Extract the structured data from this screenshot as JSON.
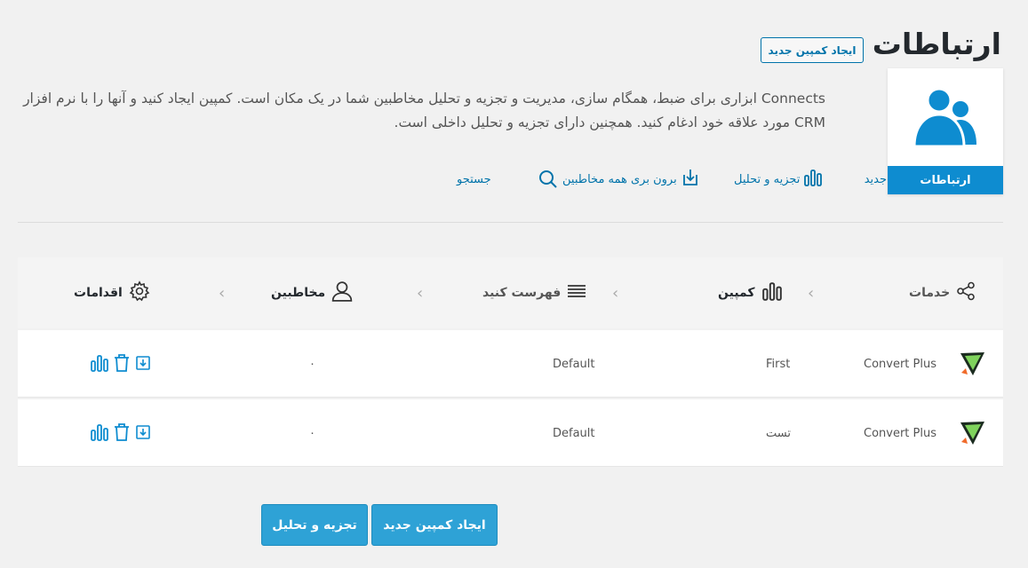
{
  "header": {
    "title": "ارتباطات",
    "new_campaign_button": "ایجاد کمپین جدید",
    "logo_label": "ارتباطات",
    "description": "Connects ابزاری برای ضبط، همگام سازی، مدیریت و تجزیه و تحلیل مخاطبین شما در یک مکان است. کمپین ایجاد کنید و آنها را با نرم افزار CRM مورد علاقه خود ادغام کنید. همچنین دارای تجزیه و تحلیل داخلی است."
  },
  "actions": {
    "new_partial": "جدید",
    "analytics": "تجزیه و تحلیل",
    "export_all": "برون بری همه مخاطبین",
    "search": "جستجو"
  },
  "table": {
    "columns": {
      "services": "خدمات",
      "campaign": "کمپین",
      "list": "فهرست کنید",
      "contacts": "مخاطبین",
      "actions": "اقدامات"
    },
    "rows": [
      {
        "service": "Convert Plus",
        "campaign": "First",
        "list": "Default",
        "contacts": "۰"
      },
      {
        "service": "Convert Plus",
        "campaign": "تست",
        "list": "Default",
        "contacts": "۰"
      }
    ]
  },
  "footer": {
    "new_campaign_button": "ایجاد کمپین جدید",
    "analytics_button": "تجزیه و تحلیل"
  },
  "colors": {
    "accent": "#0073aa",
    "brand_blue": "#0e8cd0",
    "button_blue": "#2ea2d6"
  },
  "icons": [
    "contacts-logo-icon",
    "bar-chart-icon",
    "download-icon",
    "search-icon",
    "share-icon",
    "list-icon",
    "user-icon",
    "gear-icon",
    "trash-icon",
    "convert-plus-icon"
  ]
}
